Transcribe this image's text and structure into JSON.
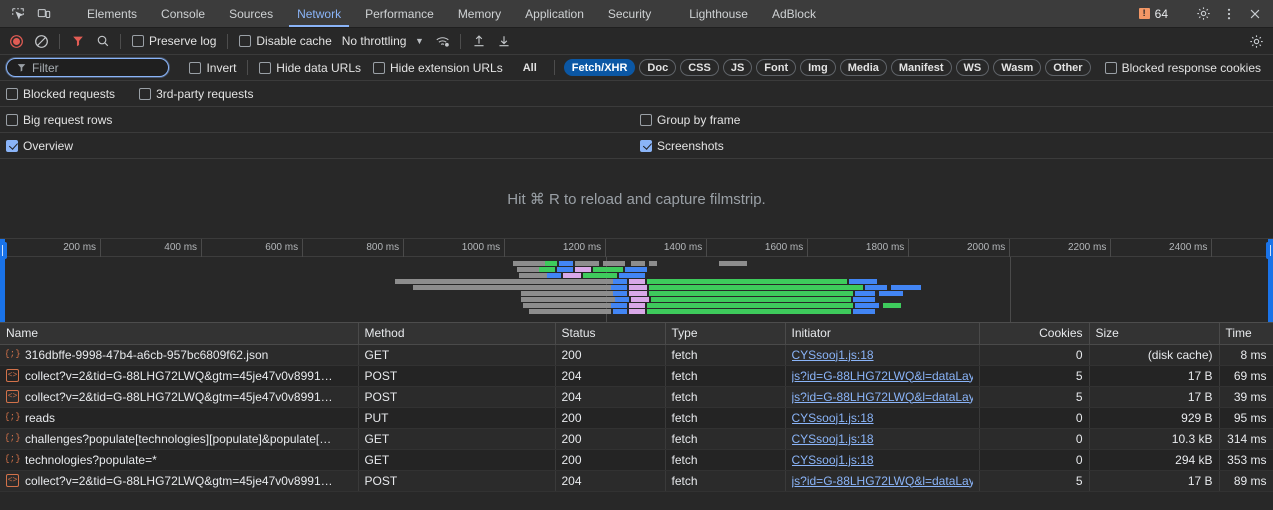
{
  "tabbar": {
    "left_icons": [
      {
        "name": "inspect-element-icon",
        "glyph": "⌖"
      },
      {
        "name": "device-toolbar-icon",
        "glyph": "▭"
      }
    ],
    "tabs": [
      {
        "label": "Elements",
        "active": false
      },
      {
        "label": "Console",
        "active": false
      },
      {
        "label": "Sources",
        "active": false
      },
      {
        "label": "Network",
        "active": true
      },
      {
        "label": "Performance",
        "active": false
      },
      {
        "label": "Memory",
        "active": false
      },
      {
        "label": "Application",
        "active": false
      },
      {
        "label": "Security",
        "active": false
      },
      {
        "label": "Lighthouse",
        "active": false
      },
      {
        "label": "AdBlock",
        "active": false
      }
    ],
    "error_count": "64",
    "error_badge_glyph": "!",
    "settings_icon": "gear-icon",
    "more_icon": "kebab-menu-icon",
    "close_icon": "close-icon"
  },
  "toolbar": {
    "record_title": "record-button",
    "clear_title": "clear-button",
    "filter_title": "filter-toggle",
    "search_title": "search-button",
    "preserve_log": "Preserve log",
    "preserve_log_checked": false,
    "disable_cache": "Disable cache",
    "disable_cache_checked": false,
    "throttling": "No throttling",
    "network_conditions_icon": "wifi-settings-icon",
    "import_icon": "import-har-icon",
    "export_icon": "export-har-icon",
    "panel_settings_icon": "gear-icon"
  },
  "filterbar": {
    "placeholder": "Filter",
    "filter_icon": "funnel-icon",
    "invert": "Invert",
    "invert_checked": false,
    "hide_data_urls": "Hide data URLs",
    "hide_data_urls_checked": false,
    "hide_extension_urls": "Hide extension URLs",
    "hide_extension_urls_checked": false,
    "types": [
      {
        "label": "All",
        "selected": false
      },
      {
        "label": "Fetch/XHR",
        "selected": true
      },
      {
        "label": "Doc",
        "selected": false
      },
      {
        "label": "CSS",
        "selected": false
      },
      {
        "label": "JS",
        "selected": false
      },
      {
        "label": "Font",
        "selected": false
      },
      {
        "label": "Img",
        "selected": false
      },
      {
        "label": "Media",
        "selected": false
      },
      {
        "label": "Manifest",
        "selected": false
      },
      {
        "label": "WS",
        "selected": false
      },
      {
        "label": "Wasm",
        "selected": false
      },
      {
        "label": "Other",
        "selected": false
      }
    ],
    "blocked_response_cookies": "Blocked response cookies",
    "blocked_response_cookies_checked": false,
    "blocked_requests": "Blocked requests",
    "blocked_requests_checked": false,
    "third_party_requests": "3rd-party requests",
    "third_party_requests_checked": false,
    "big_request_rows": "Big request rows",
    "big_request_rows_checked": false,
    "group_by_frame": "Group by frame",
    "group_by_frame_checked": false,
    "overview": "Overview",
    "overview_checked": true,
    "screenshots": "Screenshots",
    "screenshots_checked": true
  },
  "filmstrip": {
    "message": "Hit ⌘ R to reload and capture filmstrip."
  },
  "overview": {
    "ticks": [
      "200 ms",
      "400 ms",
      "600 ms",
      "800 ms",
      "1000 ms",
      "1200 ms",
      "1400 ms",
      "1600 ms",
      "1800 ms",
      "2000 ms",
      "2200 ms",
      "2400 ms"
    ],
    "colors": {
      "queueing": "#8d8d8d",
      "request_sent": "#4285f4",
      "waiting": "#d9a8e8",
      "download": "#3ecb5c",
      "accent": "#1a73e8"
    }
  },
  "table": {
    "columns": [
      "Name",
      "Method",
      "Status",
      "Type",
      "Initiator",
      "Cookies",
      "Size",
      "Time"
    ],
    "rows": [
      {
        "icon": "json-icon",
        "name": "316dbffe-9998-47b4-a6cb-957bc6809f62.json",
        "method": "GET",
        "status": "200",
        "status_dim": true,
        "type": "fetch",
        "initiator": "CYSsooj1.js:18",
        "cookies": "0",
        "size": "(disk cache)",
        "size_dim": true,
        "time": "8 ms"
      },
      {
        "icon": "doc-icon",
        "name": "collect?v=2&tid=G-88LHG72LWQ&gtm=45je47v0v8991…",
        "method": "POST",
        "status": "204",
        "status_dim": false,
        "type": "fetch",
        "initiator": "js?id=G-88LHG72LWQ&l=dataLay",
        "cookies": "5",
        "size": "17 B",
        "size_dim": false,
        "time": "69 ms"
      },
      {
        "icon": "doc-icon",
        "name": "collect?v=2&tid=G-88LHG72LWQ&gtm=45je47v0v8991…",
        "method": "POST",
        "status": "204",
        "status_dim": false,
        "type": "fetch",
        "initiator": "js?id=G-88LHG72LWQ&l=dataLay",
        "cookies": "5",
        "size": "17 B",
        "size_dim": false,
        "time": "39 ms"
      },
      {
        "icon": "json-icon",
        "name": "reads",
        "method": "PUT",
        "status": "200",
        "status_dim": false,
        "type": "fetch",
        "initiator": "CYSsooj1.js:18",
        "cookies": "0",
        "size": "929 B",
        "size_dim": false,
        "time": "95 ms"
      },
      {
        "icon": "json-icon",
        "name": "challenges?populate[technologies][populate]&populate[…",
        "method": "GET",
        "status": "200",
        "status_dim": false,
        "type": "fetch",
        "initiator": "CYSsooj1.js:18",
        "cookies": "0",
        "size": "10.3 kB",
        "size_dim": false,
        "time": "314 ms"
      },
      {
        "icon": "json-icon",
        "name": "technologies?populate=*",
        "method": "GET",
        "status": "200",
        "status_dim": false,
        "type": "fetch",
        "initiator": "CYSsooj1.js:18",
        "cookies": "0",
        "size": "294 kB",
        "size_dim": false,
        "time": "353 ms"
      },
      {
        "icon": "doc-icon",
        "name": "collect?v=2&tid=G-88LHG72LWQ&gtm=45je47v0v8991…",
        "method": "POST",
        "status": "204",
        "status_dim": false,
        "type": "fetch",
        "initiator": "js?id=G-88LHG72LWQ&l=dataLay",
        "cookies": "5",
        "size": "17 B",
        "size_dim": false,
        "time": "89 ms"
      }
    ]
  }
}
